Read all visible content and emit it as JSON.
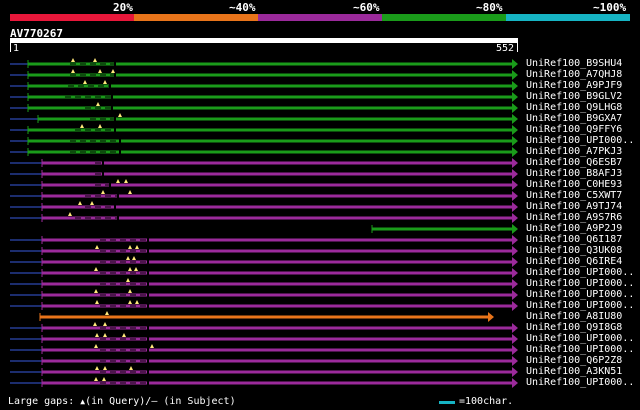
{
  "coverage_legend": {
    "labels": [
      "20%",
      "~40%",
      "~60%",
      "~80%",
      "~100%"
    ],
    "colors": [
      "#e8173a",
      "#e8741a",
      "#9b2a9b",
      "#1a9b1a",
      "#16b4c4"
    ]
  },
  "query": {
    "title": "AV770267",
    "start": "1",
    "end": "552"
  },
  "hits": [
    {
      "label": "UniRef100_B9SHU4",
      "color": "#1a9b1a"
    },
    {
      "label": "UniRef100_A7QHJ8",
      "color": "#1a9b1a"
    },
    {
      "label": "UniRef100_A9PJF9",
      "color": "#1a9b1a"
    },
    {
      "label": "UniRef100_B9GLV2",
      "color": "#1a9b1a"
    },
    {
      "label": "UniRef100_Q9LHG8",
      "color": "#1a9b1a"
    },
    {
      "label": "UniRef100_B9GXA7",
      "color": "#1a9b1a"
    },
    {
      "label": "UniRef100_Q9FFY6",
      "color": "#1a9b1a"
    },
    {
      "label": "UniRef100_UPI000..",
      "color": "#1a9b1a"
    },
    {
      "label": "UniRef100_A7PKJ3",
      "color": "#1a9b1a"
    },
    {
      "label": "UniRef100_Q6ESB7",
      "color": "#9b2a9b"
    },
    {
      "label": "UniRef100_B8AFJ3",
      "color": "#9b2a9b"
    },
    {
      "label": "UniRef100_C0HE93",
      "color": "#9b2a9b"
    },
    {
      "label": "UniRef100_C5XWT7",
      "color": "#9b2a9b"
    },
    {
      "label": "UniRef100_A9TJ74",
      "color": "#9b2a9b"
    },
    {
      "label": "UniRef100_A9S7R6",
      "color": "#9b2a9b"
    },
    {
      "label": "UniRef100_A9P2J9",
      "color": "#1a9b1a"
    },
    {
      "label": "UniRef100_Q6I187",
      "color": "#9b2a9b"
    },
    {
      "label": "UniRef100_Q3UK08",
      "color": "#9b2a9b"
    },
    {
      "label": "UniRef100_Q6IRE4",
      "color": "#9b2a9b"
    },
    {
      "label": "UniRef100_UPI000..",
      "color": "#9b2a9b"
    },
    {
      "label": "UniRef100_UPI000..",
      "color": "#9b2a9b"
    },
    {
      "label": "UniRef100_UPI000..",
      "color": "#9b2a9b"
    },
    {
      "label": "UniRef100_UPI000..",
      "color": "#9b2a9b"
    },
    {
      "label": "UniRef100_A8IU80",
      "color": "#e8741a"
    },
    {
      "label": "UniRef100_Q9I8G8",
      "color": "#9b2a9b"
    },
    {
      "label": "UniRef100_UPI000..",
      "color": "#9b2a9b"
    },
    {
      "label": "UniRef100_UPI000..",
      "color": "#9b2a9b"
    },
    {
      "label": "UniRef100_Q6P2Z8",
      "color": "#9b2a9b"
    },
    {
      "label": "UniRef100_A3KN51",
      "color": "#9b2a9b"
    },
    {
      "label": "UniRef100_UPI000..",
      "color": "#9b2a9b"
    }
  ],
  "footer": {
    "gaps_text": "Large gaps: ",
    "query_marker": "▲",
    "query_text": "(in Query)/",
    "subject_text": "– (in Subject)",
    "scale_text": "=100char.",
    "scale_color": "#16b4c4"
  }
}
